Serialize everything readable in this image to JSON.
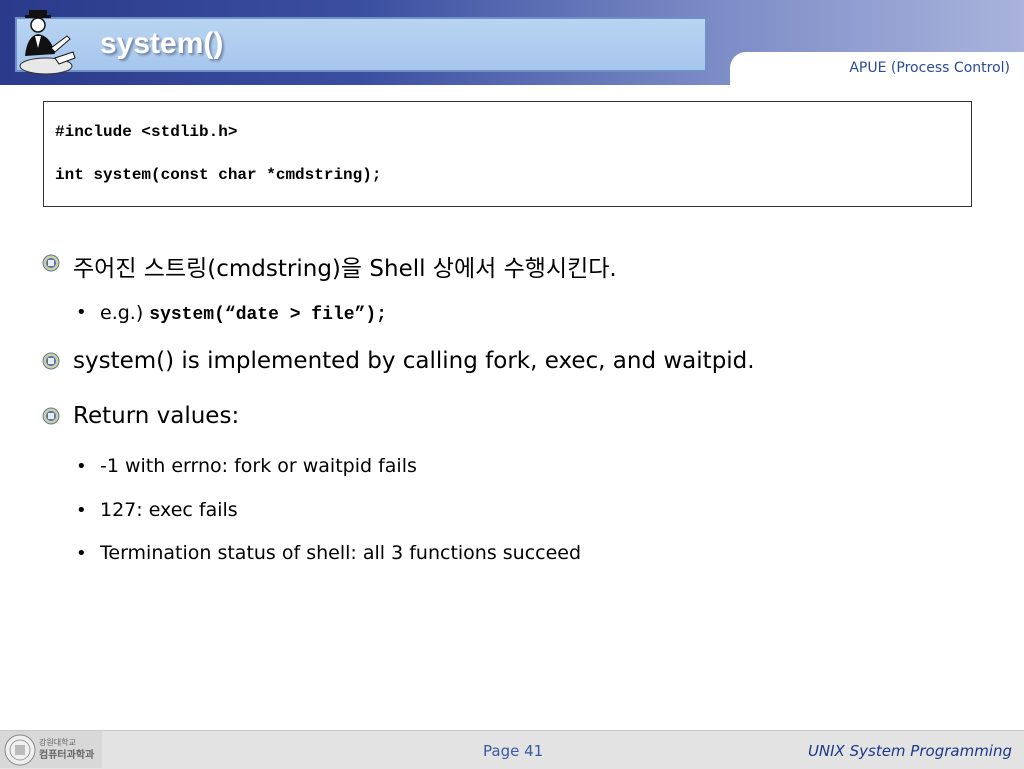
{
  "slide": {
    "title": "system()",
    "course_tag": "APUE (Process Control)"
  },
  "code": {
    "lines": [
      "#include <stdlib.h>",
      "int system(const char *cmdstring);"
    ]
  },
  "bullets": {
    "b1": {
      "ko_part1": "주어진 스트링",
      "paren": "(cmdstring)",
      "ko_part2": "을 ",
      "shell": "Shell",
      "ko_part3": " 상에서 수행시킨다.",
      "example_prefix": "e.g.) ",
      "example_code": "system(“date > file”);"
    },
    "b2": {
      "text": "system() is implemented by calling fork, exec, and waitpid."
    },
    "b3": {
      "text": "Return values:",
      "items": [
        "-1 with errno: fork or waitpid fails",
        "127: exec fails",
        "Termination status of shell: all 3 functions succeed"
      ]
    }
  },
  "footer": {
    "page": "Page 41",
    "course": "UNIX System Programming",
    "logo_text_top": "강원대학교",
    "logo_text_bottom": "컴퓨터과학과"
  },
  "colors": {
    "header_dark": "#2b3a8a",
    "title_box": "#a6c6ec",
    "accent_blue": "#2a4a9a"
  }
}
